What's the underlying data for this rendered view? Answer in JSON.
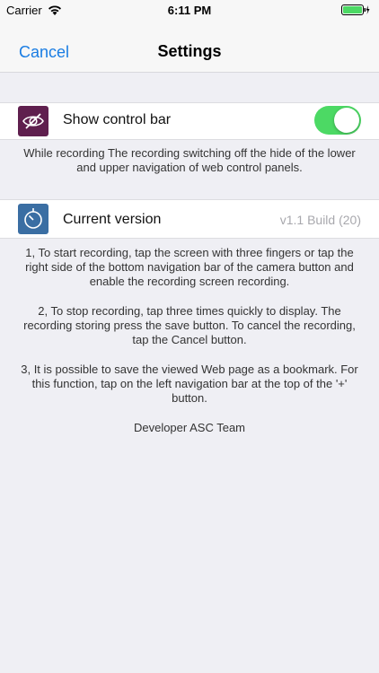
{
  "status": {
    "carrier": "Carrier",
    "time": "6:11 PM"
  },
  "nav": {
    "cancel_label": "Cancel",
    "title": "Settings"
  },
  "settings": {
    "control_bar": {
      "label": "Show control bar",
      "icon": "eye-slash-icon",
      "enabled": true,
      "note": "While recording The recording switching off the hide of the lower and upper navigation of web control panels."
    },
    "version": {
      "label": "Current version",
      "icon": "timer-icon",
      "value": "v1.1 Build (20)"
    }
  },
  "info": {
    "p1": "1, To start recording, tap the screen with three fingers or tap the right side of the bottom navigation bar of the camera button and enable the recording screen recording.",
    "p2": "2, To stop recording, tap three times quickly to display. The recording storing press the save button. To cancel the recording, tap the Cancel button.",
    "p3": "3, It is possible to save the viewed Web page as a bookmark. For this function, tap on the left navigation bar at the top of the '+' button.",
    "developer": "Developer ASC Team"
  },
  "colors": {
    "accent": "#1a7de3",
    "toggle_on": "#4cd964",
    "control_icon_bg": "#5f1f4e",
    "version_icon_bg": "#3a6ea3"
  }
}
